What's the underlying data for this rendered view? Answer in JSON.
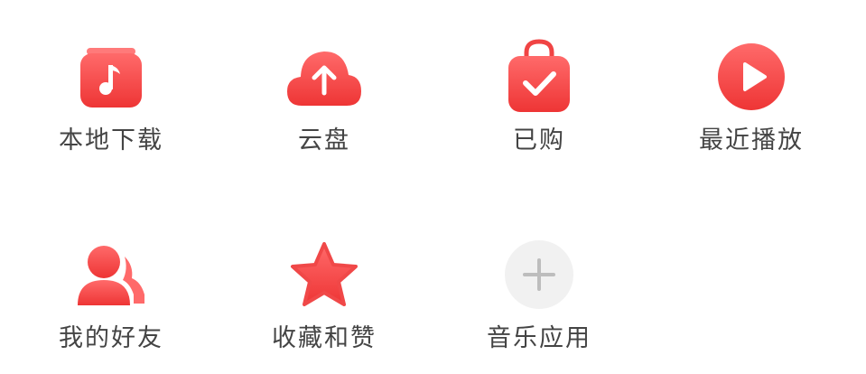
{
  "colors": {
    "accent": "#ef3b3b",
    "accent_light": "#ff6b6b",
    "label": "#444444",
    "add_bg": "#f1f1f1",
    "add_glyph": "#bdbdbd"
  },
  "apps": [
    {
      "label": "本地下载",
      "icon": "local-download-icon"
    },
    {
      "label": "云盘",
      "icon": "cloud-upload-icon"
    },
    {
      "label": "已购",
      "icon": "purchased-bag-icon"
    },
    {
      "label": "最近播放",
      "icon": "play-circle-icon"
    },
    {
      "label": "我的好友",
      "icon": "friends-icon"
    },
    {
      "label": "收藏和赞",
      "icon": "star-icon"
    },
    {
      "label": "音乐应用",
      "icon": "add-icon"
    }
  ]
}
